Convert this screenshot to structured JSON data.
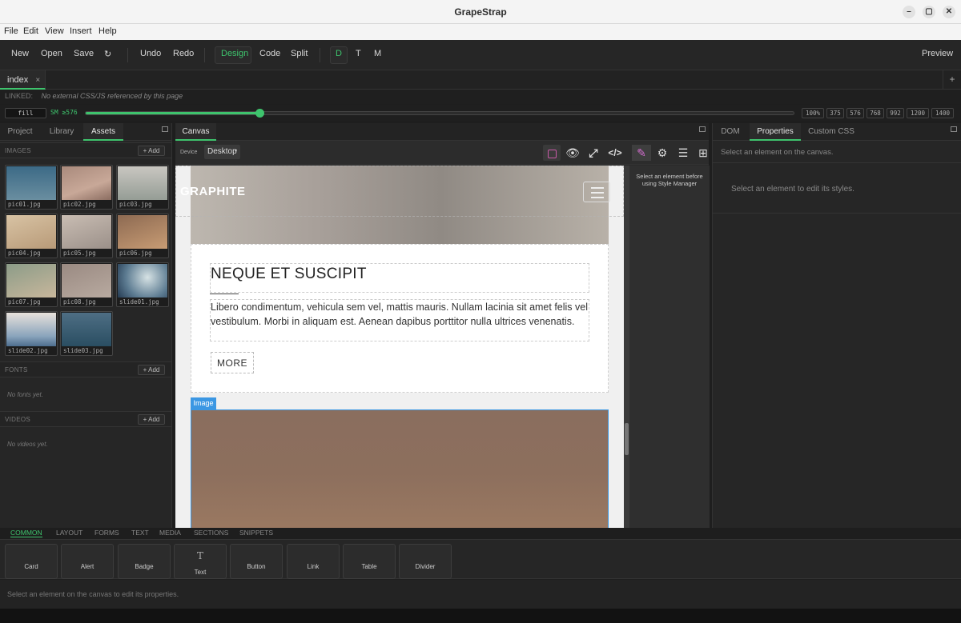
{
  "window": {
    "title": "GrapeStrap"
  },
  "menu": [
    "File",
    "Edit",
    "View",
    "Insert",
    "Help"
  ],
  "toolbar": {
    "new": "New",
    "open": "Open",
    "save": "Save",
    "refresh": "↻",
    "undo": "Undo",
    "redo": "Redo",
    "design": "Design",
    "code": "Code",
    "split": "Split",
    "d": "D",
    "t": "T",
    "m": "M",
    "preview": "Preview",
    "accent": "#3ec46d"
  },
  "doc_tabs": [
    {
      "label": "index",
      "close": "×"
    }
  ],
  "tab_add": "+",
  "linked": {
    "label": "LINKED:",
    "text": "No external CSS/JS referenced by this page"
  },
  "breakpoint": {
    "fill": "fill",
    "label": "SM ≥576",
    "level_pct": 24.5,
    "widths": [
      "100%",
      "375",
      "576",
      "768",
      "992",
      "1200",
      "1400"
    ]
  },
  "left_panel": {
    "tabs": [
      "Project",
      "Library",
      "Assets"
    ],
    "active_tab": "Assets",
    "images_header": "IMAGES",
    "add": "+ Add",
    "images": [
      "pic01.jpg",
      "pic02.jpg",
      "pic03.jpg",
      "pic04.jpg",
      "pic05.jpg",
      "pic06.jpg",
      "pic07.jpg",
      "pic08.jpg",
      "slide01.jpg",
      "slide02.jpg",
      "slide03.jpg"
    ],
    "fonts_header": "FONTS",
    "fonts_empty": "No fonts yet.",
    "videos_header": "VIDEOS",
    "videos_empty": "No videos yet."
  },
  "canvas": {
    "tab": "Canvas",
    "device_label": "Device",
    "device_value": "Desktop",
    "brand": "GRAPHITE",
    "heading": "NEQUE ET SUSCIPIT",
    "paragraph": "Libero condimentum, vehicula sem vel, mattis mauris. Nullam lacinia sit amet felis vel vestibulum. Morbi in aliquam est. Aenean dapibus porttitor nulla ultrices venenatis.",
    "button": "MORE",
    "image_badge": "Image",
    "style_hint": "Select an element before using Style Manager"
  },
  "right_panel": {
    "tabs": [
      "DOM",
      "Properties",
      "Custom CSS"
    ],
    "active_tab": "Properties",
    "select_hint": "Select an element on the canvas.",
    "style_hint": "Select an element to edit its styles."
  },
  "blocks": {
    "categories": [
      "COMMON",
      "LAYOUT",
      "FORMS",
      "TEXT",
      "MEDIA",
      "SECTIONS",
      "SNIPPETS"
    ],
    "active": "COMMON",
    "items": [
      "Card",
      "Alert",
      "Badge",
      "Text",
      "Button",
      "Link",
      "Table",
      "Divider"
    ],
    "text_glyph": "T"
  },
  "status": "Select an element on the canvas to edit its properties."
}
